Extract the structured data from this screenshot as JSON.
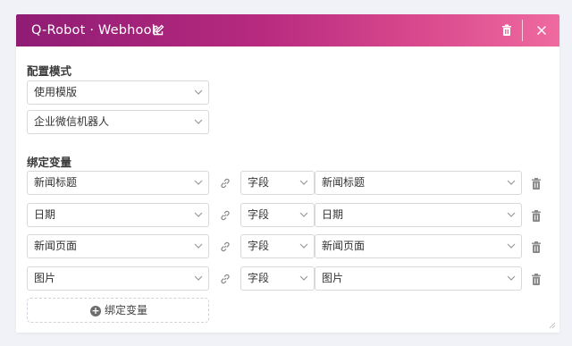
{
  "header": {
    "title": "Q-Robot · Webhook",
    "gradient": [
      "#8f1c74",
      "#ef6aa0"
    ]
  },
  "config": {
    "section_label": "配置模式",
    "mode_value": "使用模版",
    "template_value": "企业微信机器人"
  },
  "bindings": {
    "section_label": "绑定变量",
    "rows": [
      {
        "variable": "新闻标题",
        "type": "字段",
        "field": "新闻标题"
      },
      {
        "variable": "日期",
        "type": "字段",
        "field": "日期"
      },
      {
        "variable": "新闻页面",
        "type": "字段",
        "field": "新闻页面"
      },
      {
        "variable": "图片",
        "type": "字段",
        "field": "图片"
      }
    ],
    "add_label": "绑定变量"
  },
  "icons": {
    "edit": "edit-icon",
    "delete": "trash-icon",
    "close": "close-icon",
    "link": "link-icon",
    "dropdown": "chevron-down-icon",
    "add": "plus-circle-icon"
  }
}
